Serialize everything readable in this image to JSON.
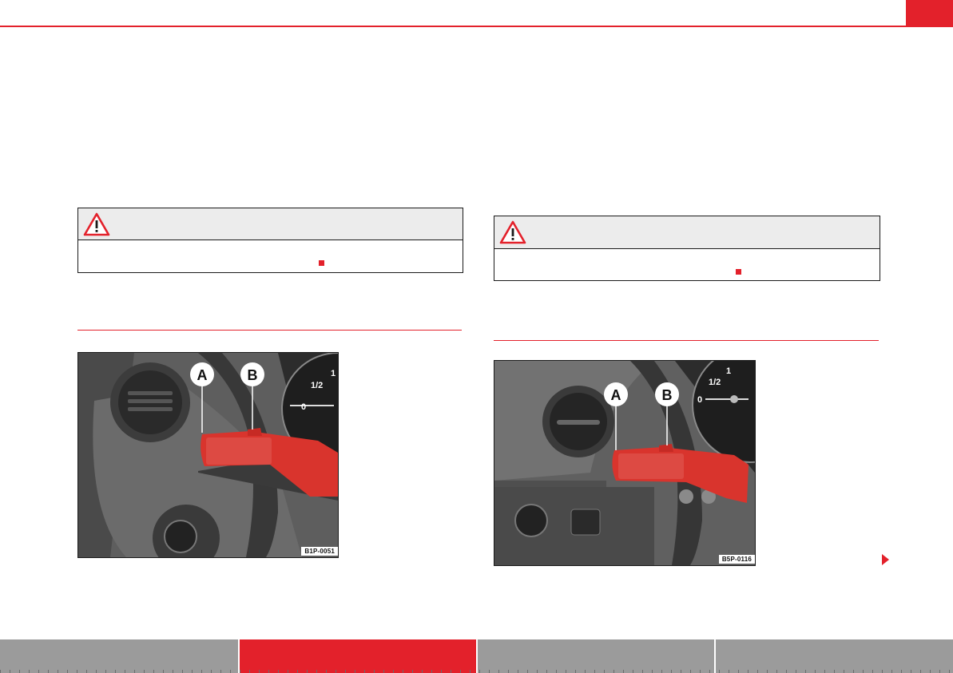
{
  "figures": [
    {
      "code": "B1P-0051",
      "callouts": [
        "A",
        "B"
      ],
      "gauge_labels": [
        "1/2",
        "1",
        "0"
      ]
    },
    {
      "code": "B5P-0116",
      "callouts": [
        "A",
        "B"
      ],
      "gauge_labels": [
        "1/2",
        "1",
        "0"
      ]
    }
  ],
  "warning_icon": "warning-triangle-icon",
  "colors": {
    "accent": "#e3212b",
    "nav_inactive": "#9b9b9b",
    "warn_header": "#ececec"
  },
  "nav": {
    "active_index": 1,
    "tab_count": 4
  }
}
